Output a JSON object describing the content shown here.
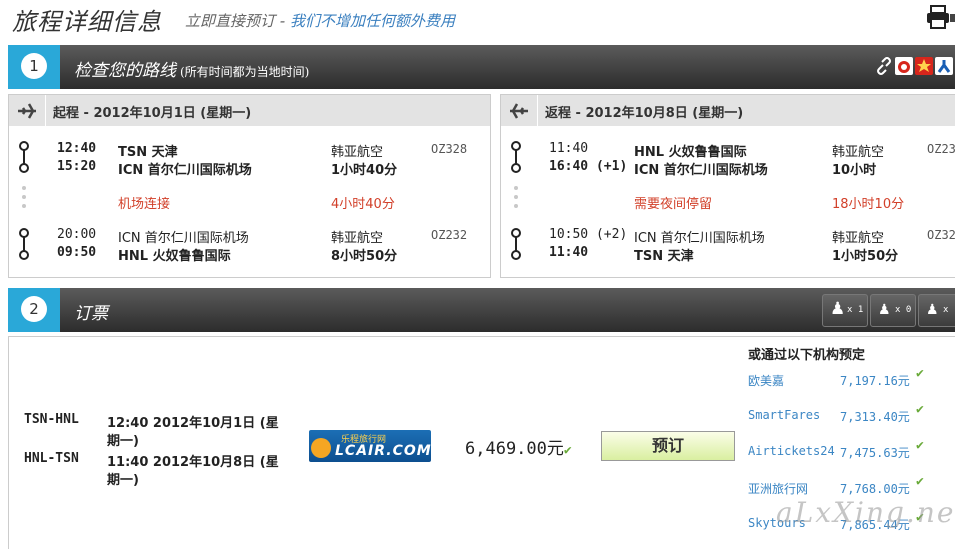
{
  "header": {
    "title": "旅程详细信息",
    "subtitle_prefix": "立即直接预订 - ",
    "subtitle_highlight": "我们不增加任何额外费用"
  },
  "section1": {
    "number": "1",
    "title": "检查您的路线",
    "note": "(所有时间都为当地时间)"
  },
  "outbound": {
    "title": "起程 - 2012年10月1日 (星期一)",
    "segments": [
      {
        "dep_time": "12:40",
        "dep_airport": "TSN 天津",
        "arr_time": "15:20",
        "arr_airport": "ICN 首尔仁川国际机场",
        "airline": "韩亚航空",
        "duration": "1小时40分",
        "flight": "OZ328"
      },
      {
        "dep_time": "20:00",
        "dep_airport": "ICN 首尔仁川国际机场",
        "arr_time": "09:50",
        "arr_airport": "HNL 火奴鲁鲁国际",
        "airline": "韩亚航空",
        "duration": "8小时50分",
        "flight": "OZ232"
      }
    ],
    "connection_label": "机场连接",
    "connection_time": "4小时40分"
  },
  "return": {
    "title": "返程 - 2012年10月8日 (星期一)",
    "segments": [
      {
        "dep_time": "11:40",
        "dep_airport": "HNL 火奴鲁鲁国际",
        "arr_time": "16:40 (+1)",
        "arr_airport": "ICN 首尔仁川国际机场",
        "airline": "韩亚航空",
        "duration": "10小时",
        "flight": "OZ23"
      },
      {
        "dep_time": "10:50 (+2)",
        "dep_airport": "ICN 首尔仁川国际机场",
        "arr_time": "11:40",
        "arr_airport": "TSN 天津",
        "airline": "韩亚航空",
        "duration": "1小时50分",
        "flight": "OZ32"
      }
    ],
    "connection_label": "需要夜间停留",
    "connection_time": "18小时10分"
  },
  "section2": {
    "number": "2",
    "title": "订票",
    "passengers": [
      {
        "icon": "adult-icon",
        "count": "x 1"
      },
      {
        "icon": "child-icon",
        "count": "x 0"
      },
      {
        "icon": "infant-icon",
        "count": "x"
      }
    ]
  },
  "booking": {
    "legs": [
      {
        "route": "TSN-HNL",
        "line1": "12:40  2012年10月1日 (星",
        "line2": "期一)"
      },
      {
        "route": "HNL-TSN",
        "line1": "11:40  2012年10月8日 (星",
        "line2": "期一)"
      }
    ],
    "logo_text_top": "乐程旅行网",
    "logo_text": "LCAIR.COM",
    "price": "6,469.00元",
    "book_label": "预订",
    "agencies_title": "或通过以下机构预定",
    "agencies": [
      {
        "name": "欧美嘉",
        "price": "7,197.16元"
      },
      {
        "name": "SmartFares",
        "price": "7,313.40元"
      },
      {
        "name": "Airtickets24",
        "price": "7,475.63元"
      },
      {
        "name": "亚洲旅行网",
        "price": "7,768.00元"
      },
      {
        "name": "Skytours",
        "price": "7,865.44元"
      }
    ]
  },
  "watermark": "aLxXing.net",
  "colors": {
    "accent": "#2aa8d8",
    "bar_dark": "#2c2c2c",
    "red": "#d2402a",
    "link": "#3b86c4",
    "check": "#6aaa3a"
  }
}
